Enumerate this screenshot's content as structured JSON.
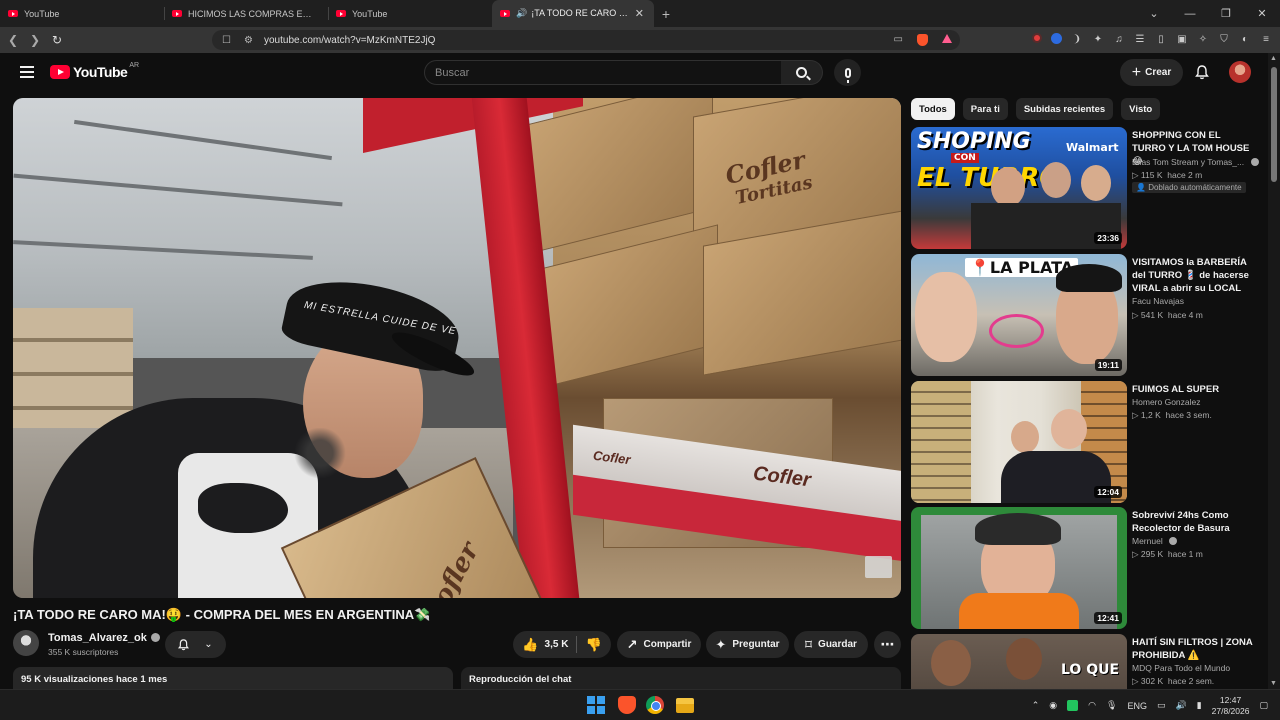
{
  "browser": {
    "tabs": [
      {
        "title": "YouTube",
        "active": false
      },
      {
        "title": "HICIMOS LAS COMPRAS EN UN MAYORISTA",
        "active": false
      },
      {
        "title": "YouTube",
        "active": false
      },
      {
        "title": "¡TA TODO RE CARO MA!🤑",
        "active": true
      }
    ],
    "new_tab": "+",
    "url": "youtube.com/watch?v=MzKmNTE2JjQ"
  },
  "masthead": {
    "logo_text": "YouTube",
    "country": "AR",
    "search_placeholder": "Buscar",
    "create_label": "Crear"
  },
  "player": {
    "box_brand": "Cofler",
    "box_product": "Tortitas",
    "shelf_brand": "Cofler",
    "cap_text": "MI ESTRELLA CUIDE DE VE"
  },
  "video": {
    "title": "¡TA TODO RE CARO MA!🤑 - COMPRA DEL MES EN ARGENTINA💸",
    "channel": "Tomas_Alvarez_ok",
    "subscribers": "355 K suscriptores",
    "likes": "3,5 K",
    "share_label": "Compartir",
    "ask_label": "Preguntar",
    "save_label": "Guardar",
    "views_time": "95 K visualizaciones  hace 1 mes",
    "chat_replay": "Reproducción del chat"
  },
  "chips": [
    "Todos",
    "Para ti",
    "Subidas recientes",
    "Visto"
  ],
  "recommendations": [
    {
      "title": "SHOPPING CON EL TURRO Y LA TOM HOUSE 😂",
      "channel": "Elias Tom Stream   y Tomas_...",
      "views": "115 K",
      "age": "hace 2 m",
      "badge": "Doblado automáticamente",
      "duration": "23:36",
      "thumb_text_1": "SHOPING",
      "thumb_text_2": "CON",
      "thumb_text_3": "EL TURRO",
      "thumb_brand": "Walmart"
    },
    {
      "title": "VISITAMOS la BARBERÍA del TURRO 💈 de hacerse VIRAL a abrir su LOCAL",
      "channel": "Facu Navajas",
      "views": "541 K",
      "age": "hace 4 m",
      "duration": "19:11",
      "thumb_text_1": "LA PLATA"
    },
    {
      "title": "FUIMOS AL SUPER",
      "channel": "Homero Gonzalez",
      "views": "1,2 K",
      "age": "hace 3 sem.",
      "duration": "12:04"
    },
    {
      "title": "Sobreviví 24hs Como Recolector de Basura",
      "channel": "Mernuel",
      "views": "295 K",
      "age": "hace 1 m",
      "duration": "12:41"
    },
    {
      "title": "HAITÍ SIN FILTROS | ZONA PROHIBIDA ⚠️",
      "channel": "MDQ Para Todo el Mundo",
      "views": "302 K",
      "age": "hace 2 sem.",
      "thumb_text_1": "LO QUE"
    }
  ],
  "taskbar": {
    "lang": "ENG",
    "time": "12:47",
    "date": "27/8/2026"
  }
}
